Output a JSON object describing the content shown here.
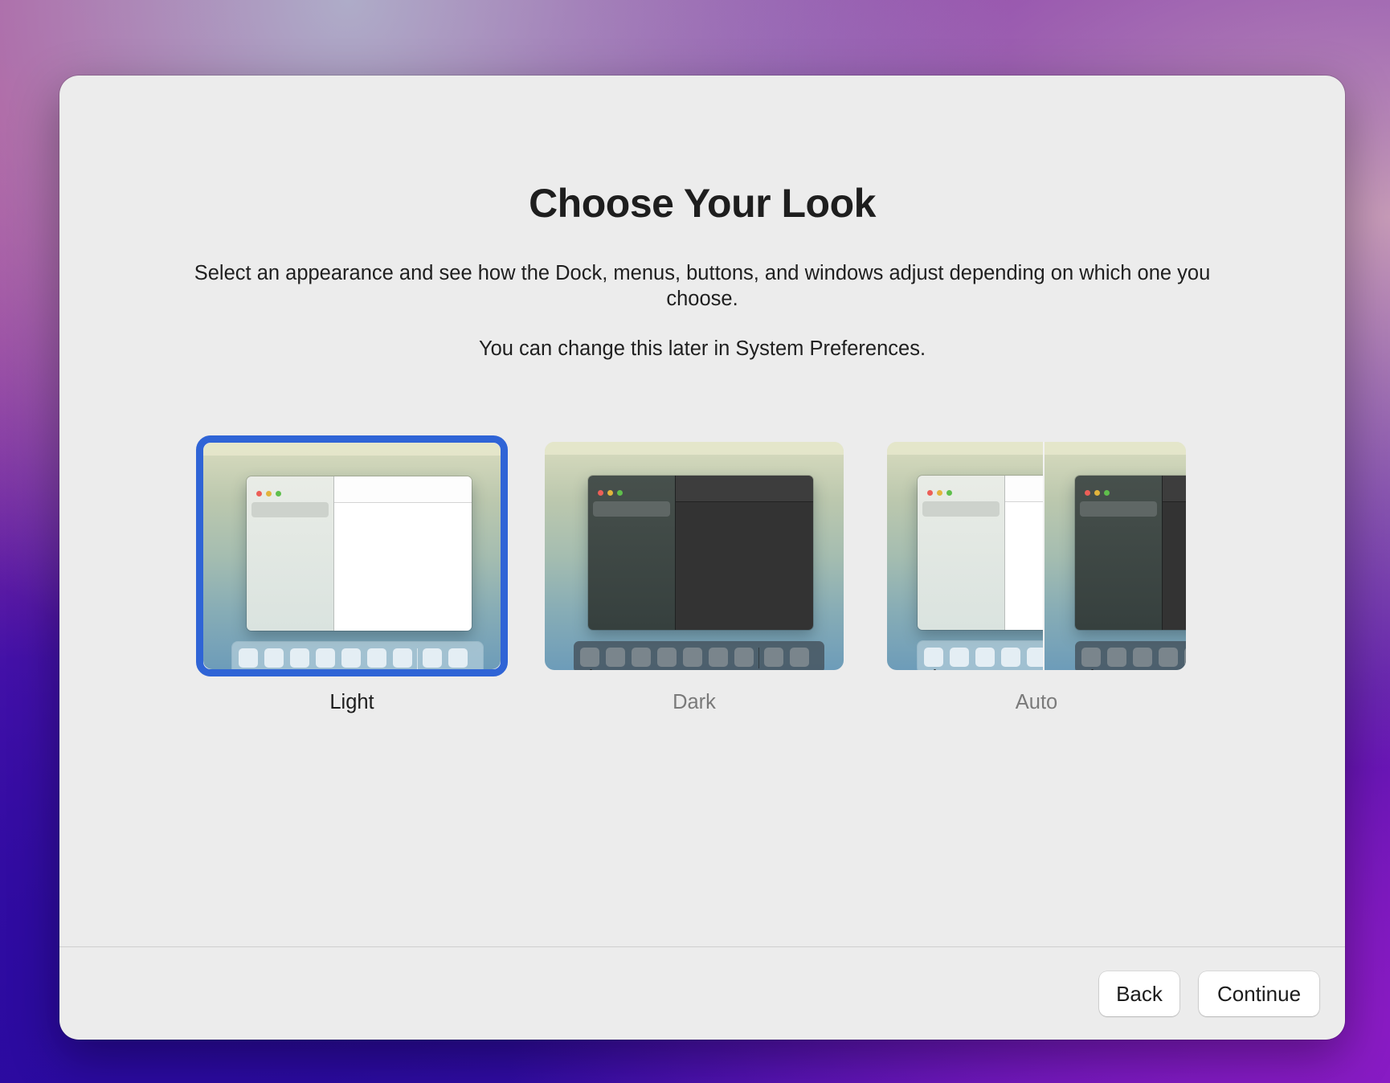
{
  "window": {
    "title": "Choose Your Look",
    "description": "Select an appearance and see how the Dock, menus, buttons, and windows adjust depending on which one you choose.",
    "note": "You can change this later in System Preferences."
  },
  "options": [
    {
      "label": "Light",
      "selected": true
    },
    {
      "label": "Dark",
      "selected": false
    },
    {
      "label": "Auto",
      "selected": false
    }
  ],
  "footer": {
    "back_label": "Back",
    "continue_label": "Continue"
  },
  "icons": {
    "menubar": "apple-logo-icon",
    "traffic_lights": [
      "close-dot",
      "minimize-dot",
      "zoom-dot"
    ]
  },
  "colors": {
    "selection_accent": "#2f64d6",
    "window_background": "#ececec"
  }
}
